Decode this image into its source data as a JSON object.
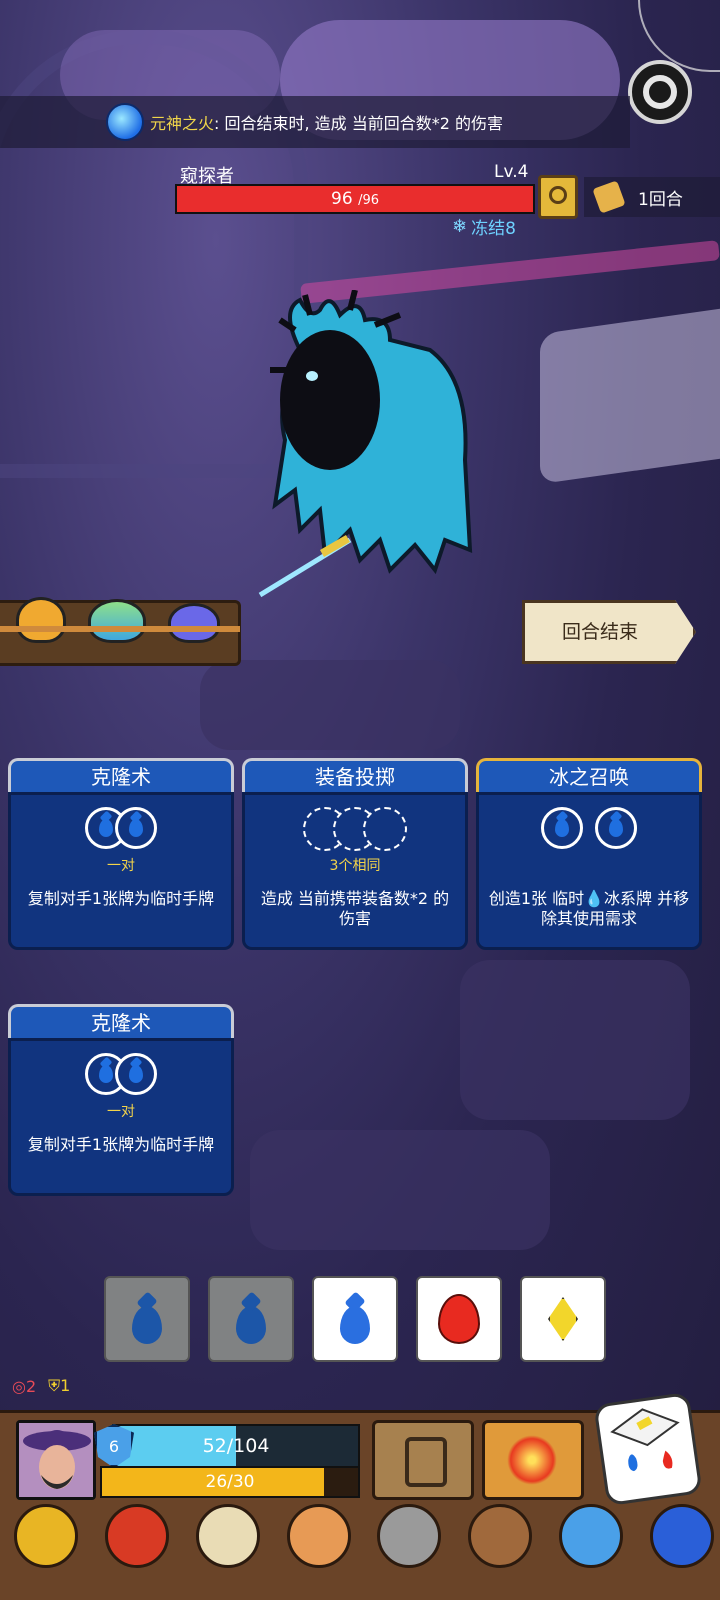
{
  "buff_banner": {
    "title": "元神之火",
    "text": ": 回合结束时, 造成 当前回合数*2 的伤害"
  },
  "enemy": {
    "name": "窥探者",
    "level": "Lv.4",
    "hp_current": "96",
    "hp_max": "/96",
    "hp_fraction": 1.0,
    "status": "冻结8"
  },
  "turn": {
    "label": "1回合"
  },
  "end_turn_button": "回合结束",
  "cards": [
    {
      "title": "克隆术",
      "requirement": "一对",
      "description": "复制对手1张牌为临时手牌"
    },
    {
      "title": "装备投掷",
      "requirement": "3个相同",
      "description": "造成 当前携带装备数*2 的伤害"
    },
    {
      "title": "冰之召唤",
      "requirement": "",
      "description": "创造1张 临时💧冰系牌 并移除其使用需求"
    },
    {
      "title": "克隆术",
      "requirement": "一对",
      "description": "复制对手1张牌为临时手牌"
    }
  ],
  "dice": [
    {
      "element": "water",
      "used": true
    },
    {
      "element": "water",
      "used": true
    },
    {
      "element": "water",
      "used": false
    },
    {
      "element": "fire",
      "used": false
    },
    {
      "element": "lightning",
      "used": false
    }
  ],
  "player": {
    "stat_red": "2",
    "stat_yellow": "1",
    "shield": "6",
    "hp": "52/104",
    "hp_fraction": 0.5,
    "energy": "26/30",
    "energy_fraction": 0.867
  },
  "colors": {
    "hp_enemy": "#e92d2d",
    "hp_player": "#5ccdf0",
    "energy": "#f3b61a",
    "card_blue": "#1e58b8"
  }
}
